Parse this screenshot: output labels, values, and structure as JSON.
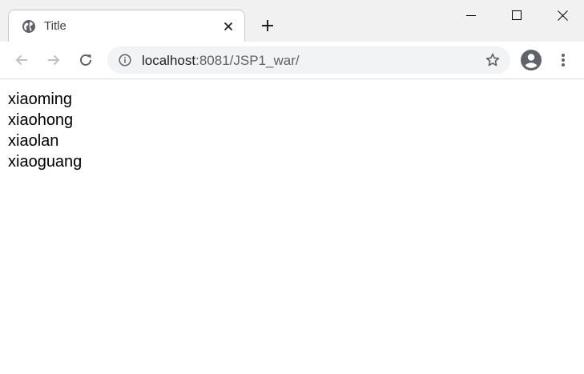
{
  "browser": {
    "tab": {
      "title": "Title",
      "icon": "globe-icon"
    },
    "window_controls": [
      "minimize-icon",
      "maximize-icon",
      "close-icon"
    ],
    "toolbar": {
      "url_host": "localhost",
      "url_rest": ":8081/JSP1_war/",
      "icons": [
        "back-arrow-icon",
        "forward-arrow-icon",
        "reload-icon",
        "info-icon",
        "star-icon",
        "profile-icon",
        "more-vert-icon"
      ]
    }
  },
  "page": {
    "names": [
      "xiaoming",
      "xiaohong",
      "xiaolan",
      "xiaoguang"
    ]
  },
  "colors": {
    "tabstrip_bg": "#f1f1f1",
    "omnibox_bg": "#f1f3f4",
    "icon_gray": "#5f6368",
    "icon_disabled": "#bdc1c6"
  }
}
